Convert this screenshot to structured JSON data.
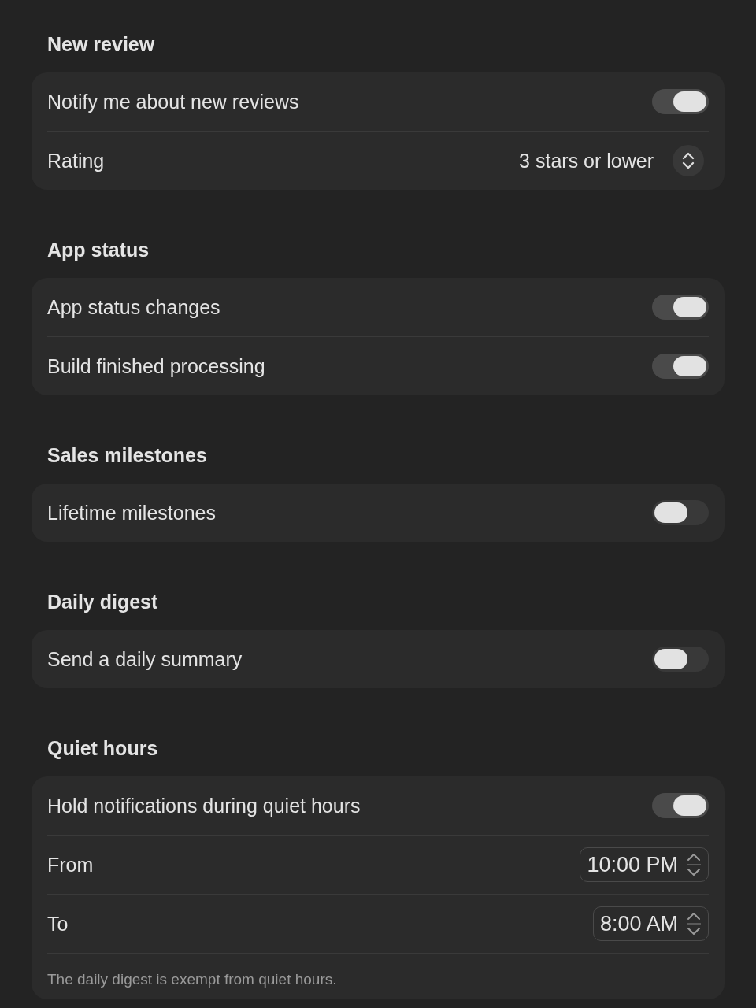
{
  "sections": [
    {
      "title": "New review",
      "rows": [
        {
          "kind": "toggle",
          "label": "Notify me about new reviews",
          "on": true
        },
        {
          "kind": "select",
          "label": "Rating",
          "value": "3 stars or lower"
        }
      ]
    },
    {
      "title": "App status",
      "rows": [
        {
          "kind": "toggle",
          "label": "App status changes",
          "on": true
        },
        {
          "kind": "toggle",
          "label": "Build finished processing",
          "on": true
        }
      ]
    },
    {
      "title": "Sales milestones",
      "rows": [
        {
          "kind": "toggle",
          "label": "Lifetime milestones",
          "on": false
        }
      ]
    },
    {
      "title": "Daily digest",
      "rows": [
        {
          "kind": "toggle",
          "label": "Send a daily summary",
          "on": false
        }
      ]
    },
    {
      "title": "Quiet hours",
      "rows": [
        {
          "kind": "toggle",
          "label": "Hold notifications during quiet hours",
          "on": true
        },
        {
          "kind": "time",
          "label": "From",
          "value": "10:00 PM"
        },
        {
          "kind": "time",
          "label": "To",
          "value": "8:00 AM"
        },
        {
          "kind": "note",
          "label": "The daily digest is exempt from quiet hours."
        }
      ]
    }
  ]
}
